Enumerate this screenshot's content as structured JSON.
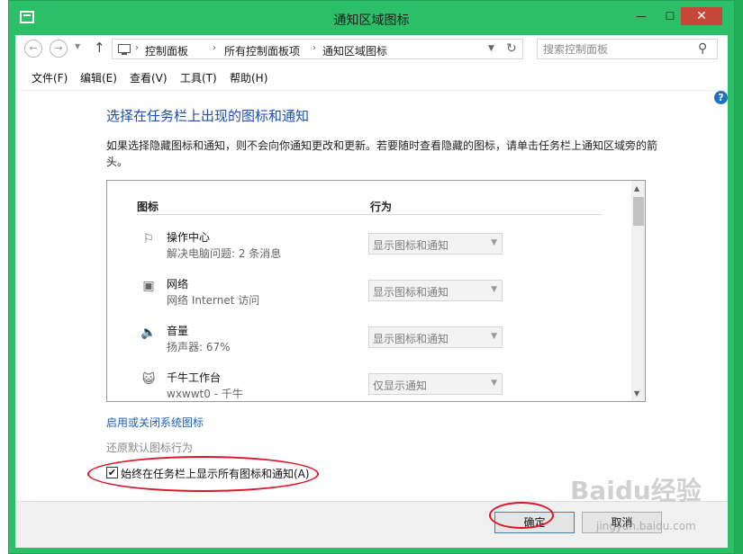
{
  "window": {
    "title": "通知区域图标",
    "close_glyph": "✕",
    "min_glyph": "—",
    "max_glyph": "☐"
  },
  "nav": {
    "back_glyph": "←",
    "forward_glyph": "→",
    "dropdown_glyph": "▼",
    "up_glyph": "↑",
    "breadcrumbs": [
      "控制面板",
      "所有控制面板项",
      "通知区域图标"
    ],
    "separator": "›",
    "refresh_glyph": "↻"
  },
  "search": {
    "placeholder": "搜索控制面板",
    "icon_glyph": "⚲"
  },
  "menu": [
    "文件(F)",
    "编辑(E)",
    "查看(V)",
    "工具(T)",
    "帮助(H)"
  ],
  "help_glyph": "?",
  "page": {
    "title": "选择在任务栏上出现的图标和通知",
    "description": "如果选择隐藏图标和通知，则不会向你通知更改和更新。若要随时查看隐藏的图标，请单击任务栏上通知区域旁的箭头。"
  },
  "table": {
    "col_icon": "图标",
    "col_behavior": "行为",
    "rows": [
      {
        "name": "操作中心",
        "sub": "解决电脑问题: 2 条消息",
        "behavior": "显示图标和通知",
        "icon": "flag-icon",
        "glyph": "⚐"
      },
      {
        "name": "网络",
        "sub": "网络 Internet 访问",
        "behavior": "显示图标和通知",
        "icon": "network-icon",
        "glyph": "▣"
      },
      {
        "name": "音量",
        "sub": "扬声器: 67%",
        "behavior": "显示图标和通知",
        "icon": "speaker-icon",
        "glyph": "🔈"
      },
      {
        "name": "千牛工作台",
        "sub": "wxwwt0 - 千牛",
        "behavior": "仅显示通知",
        "icon": "qianniu-icon",
        "glyph": "😺"
      }
    ]
  },
  "links": {
    "system_icons": "启用或关闭系统图标",
    "restore": "还原默认图标行为"
  },
  "checkbox": {
    "label": "始终在任务栏上显示所有图标和通知(A)",
    "checked": true,
    "mark": "✔"
  },
  "buttons": {
    "ok": "确定",
    "cancel": "取消"
  },
  "watermark": {
    "text": "Baidu经验",
    "sub": "jingyan.baidu.com"
  },
  "colors": {
    "accent": "#2cbf68",
    "title_blue": "#1e4fa8",
    "annotation_red": "#e0142a"
  }
}
